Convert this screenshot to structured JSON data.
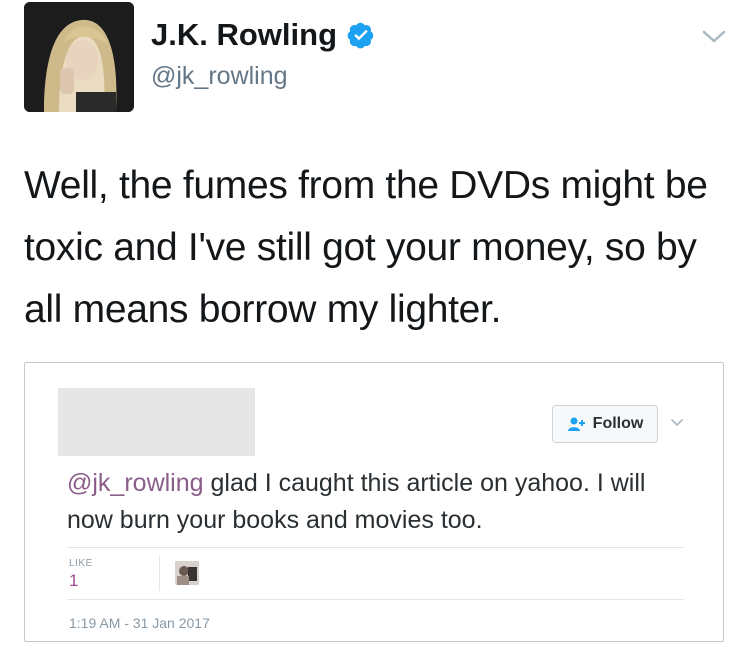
{
  "tweet": {
    "display_name": "J.K. Rowling",
    "handle": "@jk_rowling",
    "verified": true,
    "text": "Well, the fumes from the DVDs might be toxic and I've still got your money, so by all means borrow my lighter."
  },
  "embedded_tweet": {
    "follow_label": "Follow",
    "mention": "@jk_rowling",
    "text": " glad I caught this article on yahoo. I will now burn your books and movies too.",
    "like_label": "LIKE",
    "like_count": "1",
    "timestamp": "1:19 AM - 31 Jan 2017"
  },
  "colors": {
    "accent": "#1da1f2",
    "mention": "#8b5e8a",
    "like": "#9b4d8f"
  },
  "icons": [
    "verified-badge-icon",
    "chevron-down-icon",
    "follow-person-icon"
  ]
}
